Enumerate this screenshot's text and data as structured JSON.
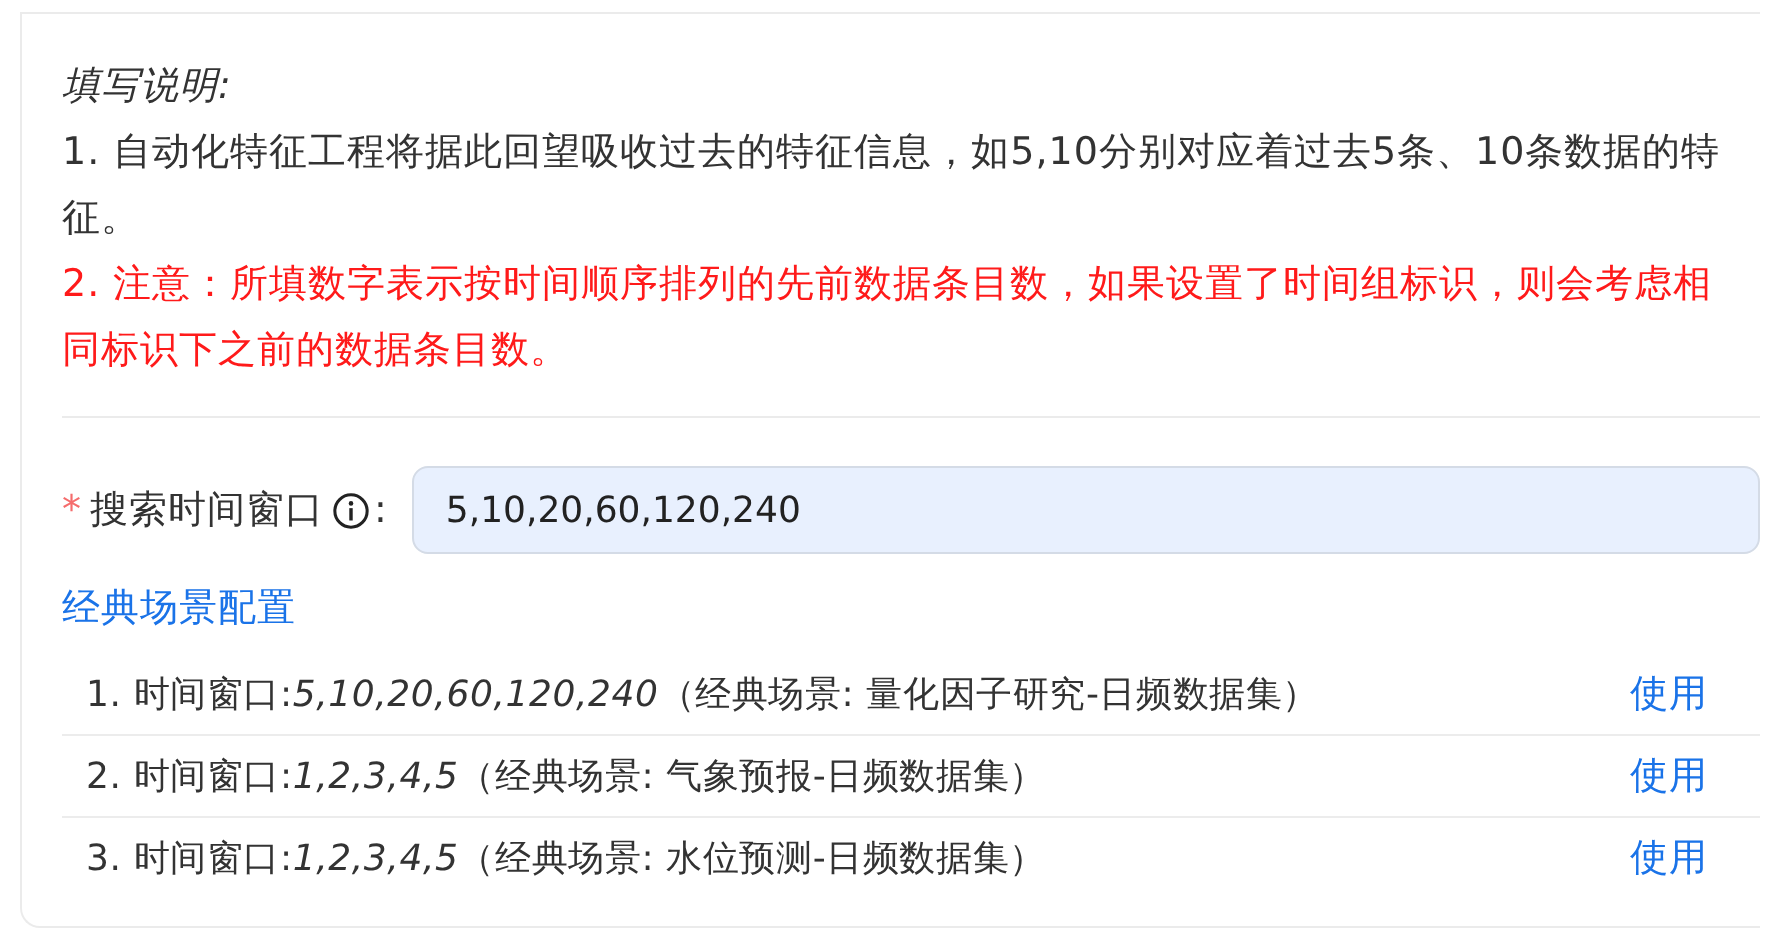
{
  "instructions": {
    "title": "填写说明:",
    "lines": [
      {
        "kind": "normal",
        "text": "1. 自动化特征工程将据此回望吸收过去的特征信息，如5,10分别对应着过去5条、10条数据的特征。"
      },
      {
        "kind": "warning",
        "text": "2. 注意：所填数字表示按时间顺序排列的先前数据条目数，如果设置了时间组标识，则会考虑相同标识下之前的数据条目数。"
      }
    ]
  },
  "field": {
    "label": "搜索时间窗口",
    "required_mark": "*",
    "colon": ":",
    "value": "5,10,20,60,120,240"
  },
  "presets": {
    "title": "经典场景配置",
    "items": [
      {
        "text": "1. 时间窗口:*5,10,20,60,120,240*（经典场景: 量化因子研究-日频数据集）",
        "action": "使用"
      },
      {
        "text": "2. 时间窗口:*1,2,3,4,5*（经典场景: 气象预报-日频数据集）",
        "action": "使用"
      },
      {
        "text": "3. 时间窗口:*1,2,3,4,5*（经典场景: 水位预测-日频数据集）",
        "action": "使用"
      }
    ]
  }
}
